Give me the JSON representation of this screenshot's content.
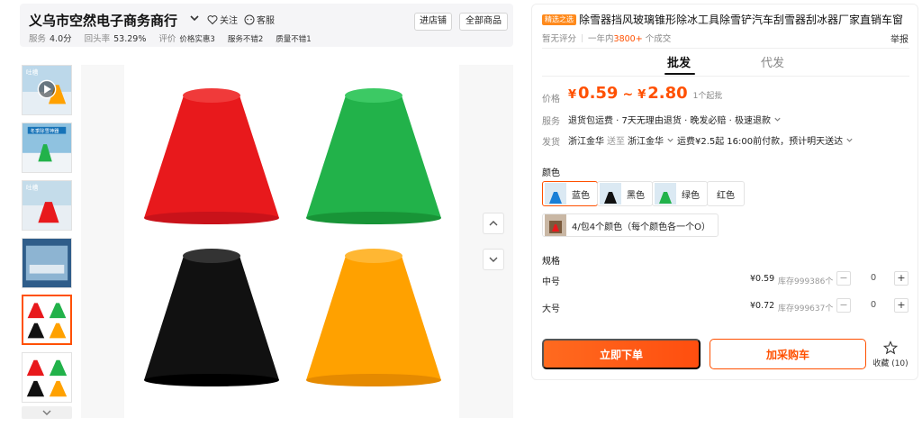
{
  "shop": {
    "name": "义乌市空然电子商务商行",
    "follow_label": "关注",
    "service_label": "客服",
    "enter_shop_label": "进店铺",
    "all_products_label": "全部商品",
    "stats": {
      "service_label": "服务",
      "service_value": "4.0分",
      "return_label": "回头率",
      "return_value": "53.29%",
      "review_label": "评价",
      "tag1": "价格实惠3",
      "tag2": "服务不错2",
      "tag3": "质量不错1"
    }
  },
  "gallery": {
    "thumbnails": [
      {
        "name": "video-thumbnail",
        "caption": "吐槽"
      },
      {
        "name": "thumbnail-2",
        "caption": "冬季除雪神器"
      },
      {
        "name": "thumbnail-3",
        "caption": "吐槽"
      },
      {
        "name": "thumbnail-4",
        "caption": ""
      },
      {
        "name": "thumbnail-5",
        "caption": ""
      },
      {
        "name": "thumbnail-6",
        "caption": ""
      }
    ],
    "active_index": 4,
    "main_image_colors": [
      "#e8191c",
      "#22b24a",
      "#111111",
      "#ffa100"
    ]
  },
  "product": {
    "tag": "精选之选",
    "title": "除雪器挡风玻璃锥形除冰工具除雪铲汽车刮雪器刮冰器厂家直销车窗",
    "rating_text": "暂无评分",
    "sales_prefix": "一年内",
    "sales_count": "3800+",
    "sales_suffix": "个成交",
    "report_label": "举报"
  },
  "tabs": [
    {
      "label": "批发",
      "active": true
    },
    {
      "label": "代发",
      "active": false
    }
  ],
  "price": {
    "label": "价格",
    "currency": "¥",
    "low": "0.59",
    "tilde": "~",
    "high": "2.80",
    "moq": "1个起批"
  },
  "service": {
    "label": "服务",
    "text": "退货包运费 · 7天无理由退货 · 晚发必赔 · 极速退款"
  },
  "shipping": {
    "label": "发货",
    "from": "浙江金华",
    "to_label": "送至",
    "to": "浙江金华",
    "fee": "运费¥2.5起",
    "time": "16:00前付款，预计明天送达"
  },
  "colors": {
    "label": "颜色",
    "options": [
      {
        "label": "蓝色",
        "selected": true,
        "swatch": "#1a7fd6"
      },
      {
        "label": "黑色",
        "selected": false,
        "swatch": "#111111"
      },
      {
        "label": "绿色",
        "selected": false,
        "swatch": "#22b24a"
      },
      {
        "label": "红色",
        "selected": false,
        "swatch": ""
      }
    ],
    "pack_option": "4/包4个颜色（每个颜色各一个O）"
  },
  "specs": {
    "label": "规格",
    "rows": [
      {
        "name": "中号",
        "price": "¥0.59",
        "stock": "库存999386个",
        "qty": "0"
      },
      {
        "name": "大号",
        "price": "¥0.72",
        "stock": "库存999637个",
        "qty": "0"
      }
    ]
  },
  "actions": {
    "buy_now": "立即下单",
    "add_cart": "加采购车",
    "favorite": "收藏 (10)"
  }
}
